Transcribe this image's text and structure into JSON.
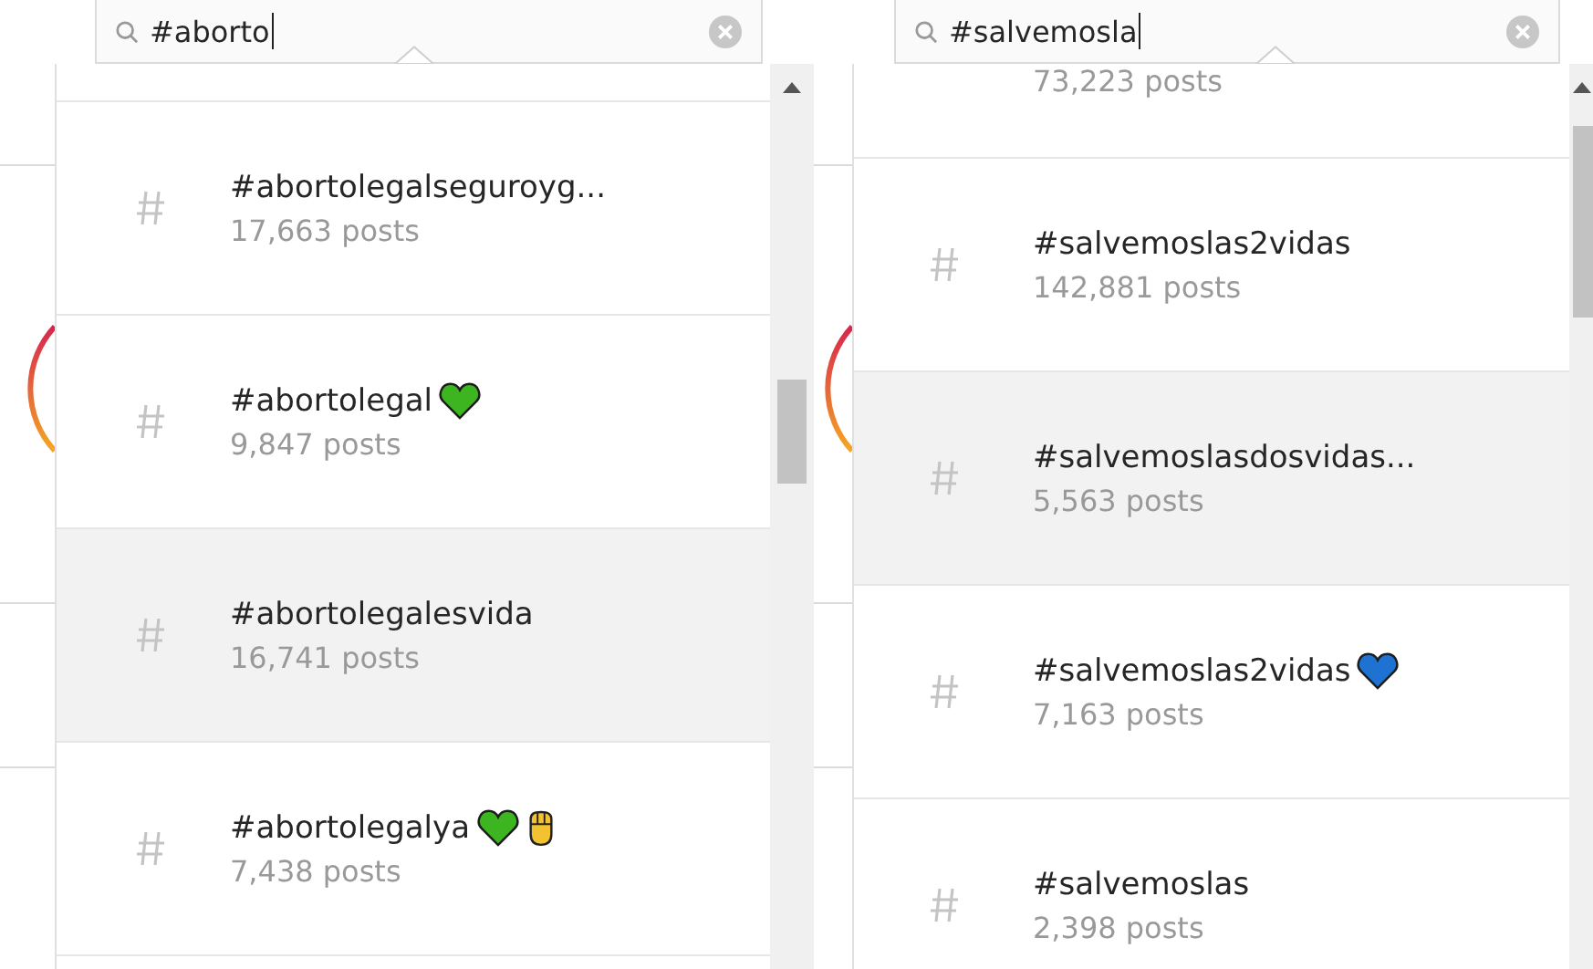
{
  "panels": [
    {
      "search": {
        "value": "#aborto"
      },
      "results": [
        {
          "tag": "#abortolegalseguroyg...",
          "posts": "17,663 posts",
          "selected": false
        },
        {
          "tag": "#abortolegal",
          "posts": "9,847 posts",
          "selected": false,
          "emoji": [
            {
              "kind": "heart",
              "color": "#3cb521"
            }
          ]
        },
        {
          "tag": "#abortolegalesvida",
          "posts": "16,741 posts",
          "selected": true
        },
        {
          "tag": "#abortolegalya",
          "posts": "7,438 posts",
          "selected": false,
          "emoji": [
            {
              "kind": "heart",
              "color": "#3cb521"
            },
            {
              "kind": "fist",
              "color": "#f2c230"
            }
          ]
        }
      ]
    },
    {
      "search": {
        "value": "#salvemosla"
      },
      "top_partial": "73,223 posts",
      "results": [
        {
          "tag": "#salvemoslas2vidas",
          "posts": "142,881 posts",
          "selected": false
        },
        {
          "tag": "#salvemoslasdosvidas...",
          "posts": "5,563 posts",
          "selected": true
        },
        {
          "tag": "#salvemoslas2vidas",
          "posts": "7,163 posts",
          "selected": false,
          "emoji": [
            {
              "kind": "heart",
              "color": "#1e73d2"
            }
          ]
        },
        {
          "tag": "#salvemoslas",
          "posts": "2,398 posts",
          "selected": false
        }
      ]
    }
  ]
}
